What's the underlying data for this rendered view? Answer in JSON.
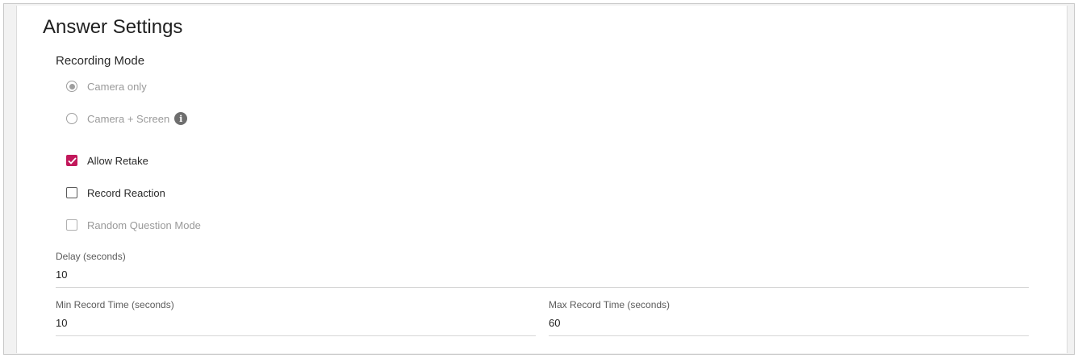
{
  "title": "Answer Settings",
  "recording_mode": {
    "label": "Recording Mode",
    "options": [
      {
        "label": "Camera only",
        "selected": true
      },
      {
        "label": "Camera + Screen",
        "selected": false
      }
    ],
    "info_icon": "info-icon"
  },
  "checkboxes": {
    "allow_retake": {
      "label": "Allow Retake",
      "checked": true
    },
    "record_reaction": {
      "label": "Record Reaction",
      "checked": false
    },
    "random_question_mode": {
      "label": "Random Question Mode",
      "checked": false,
      "disabled": true
    }
  },
  "fields": {
    "delay": {
      "label": "Delay (seconds)",
      "value": "10"
    },
    "min_record_time": {
      "label": "Min Record Time (seconds)",
      "value": "10"
    },
    "max_record_time": {
      "label": "Max Record Time (seconds)",
      "value": "60"
    }
  },
  "colors": {
    "accent": "#c2185b",
    "disabled_text": "#9a9a9a"
  }
}
